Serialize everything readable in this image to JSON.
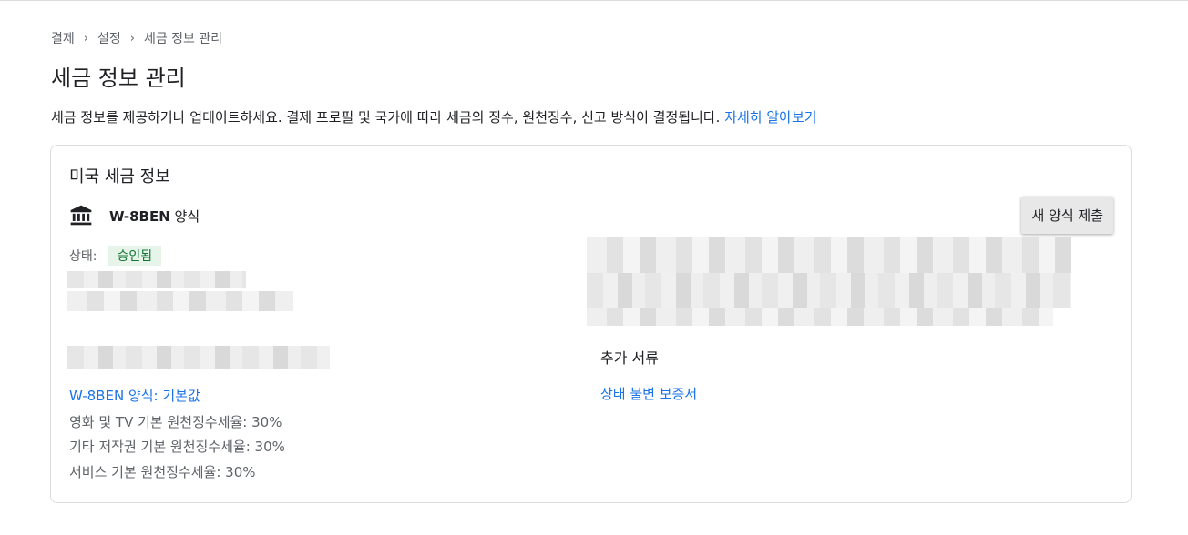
{
  "breadcrumb": {
    "items": [
      "결제",
      "설정",
      "세금 정보 관리"
    ],
    "separator": "›"
  },
  "page": {
    "title": "세금 정보 관리",
    "description": "세금 정보를 제공하거나 업데이트하세요. 결제 프로필 및 국가에 따라 세금의 징수, 원천징수, 신고 방식이 결정됩니다. ",
    "learn_more": "자세히 알아보기"
  },
  "card": {
    "title": "미국 세금 정보",
    "form_code": "W-8BEN",
    "form_suffix": " 양식",
    "bank_icon": "bank-icon",
    "submit_button": "새 양식 제출",
    "status_label": "상태:",
    "status_value": "승인됨",
    "default_form_link": "W-8BEN 양식: 기본값",
    "rates": [
      "영화 및 TV 기본 원천징수세율: 30%",
      "기타 저작권 기본 원천징수세율: 30%",
      "서비스 기본 원천징수세율: 30%"
    ],
    "extra_docs_label": "추가 서류",
    "extra_docs_link": "상태 불변 보증서"
  },
  "colors": {
    "link": "#1a73e8",
    "status_bg": "#e6f4ea",
    "status_text": "#137333"
  }
}
